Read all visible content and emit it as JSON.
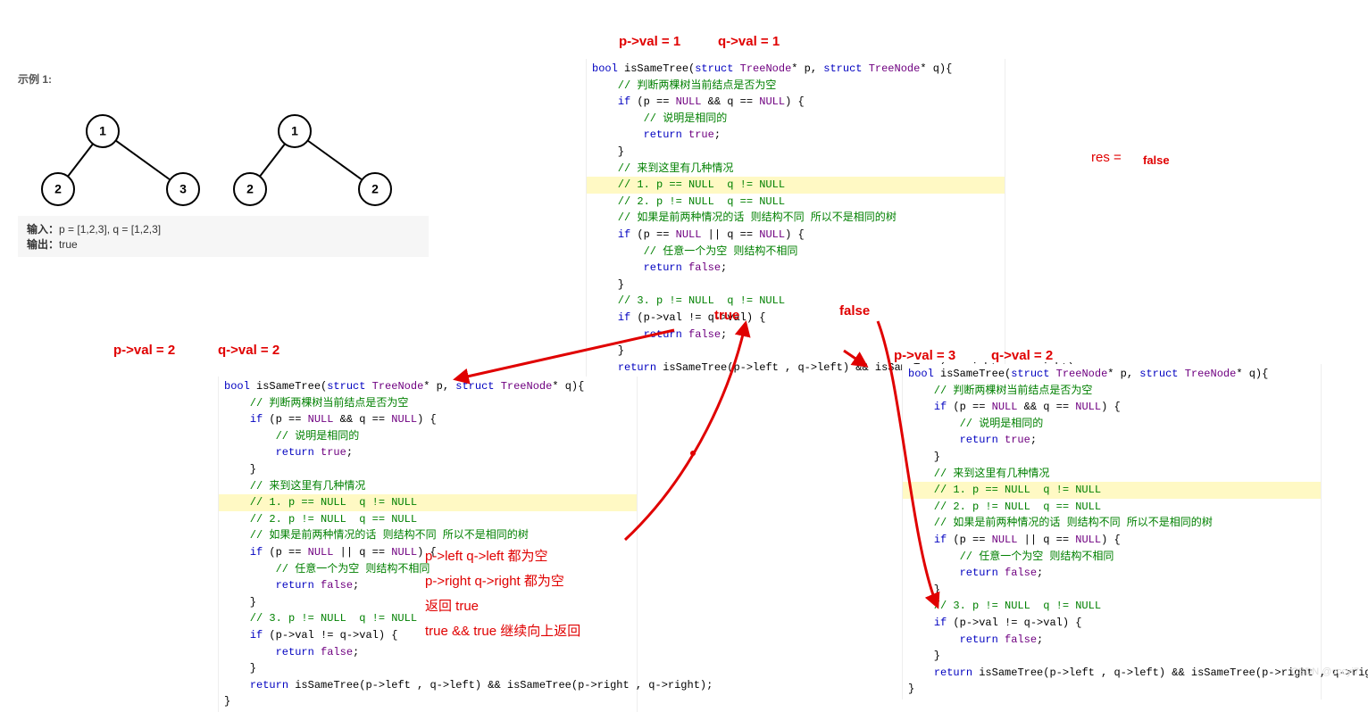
{
  "example": {
    "label": "示例 1:",
    "tree1": {
      "root": "1",
      "left": "2",
      "right": "3"
    },
    "tree2": {
      "root": "1",
      "left": "2",
      "right": "2"
    },
    "input_label": "输入：",
    "input_value": "p = [1,2,3], q = [1,2,3]",
    "output_label": "输出：",
    "output_value": "true"
  },
  "annotations": {
    "top_pval": "p->val = 1",
    "top_qval": "q->val = 1",
    "res_label": "res =",
    "res_false": "false",
    "mid_true": "true",
    "mid_false": "false",
    "left_pval": "p->val = 2",
    "left_qval": "q->val = 2",
    "right_pval": "p->val = 3",
    "right_qval": "q->val = 2",
    "note1": "p->left q->left 都为空",
    "note2": "p->right q->right 都为空",
    "note3": "返回 true",
    "note4": "true && true 继续向上返回"
  },
  "code": {
    "l1": "bool isSameTree(struct TreeNode* p, struct TreeNode* q){",
    "l2": "    // 判断两棵树当前结点是否为空",
    "l3": "    if (p == NULL && q == NULL) {",
    "l4": "        // 说明是相同的",
    "l5": "        return true;",
    "l6": "    }",
    "l7": "    // 来到这里有几种情况",
    "l8": "    // 1. p == NULL  q != NULL",
    "l9": "    // 2. p != NULL  q == NULL",
    "l10": "    // 如果是前两种情况的话 则结构不同 所以不是相同的树",
    "l11": "    if (p == NULL || q == NULL) {",
    "l12": "        // 任意一个为空 则结构不相同",
    "l13": "        return false;",
    "l14": "    }",
    "l15": "    // 3. p != NULL  q != NULL",
    "l16": "    if (p->val != q->val) {",
    "l17": "        return false;",
    "l18": "    }",
    "l19": "",
    "l20": "    return isSameTree(p->left , q->left) && isSameTree(p->right , q->right);",
    "l21": "}"
  },
  "watermark": "CSDN @cccyi7"
}
